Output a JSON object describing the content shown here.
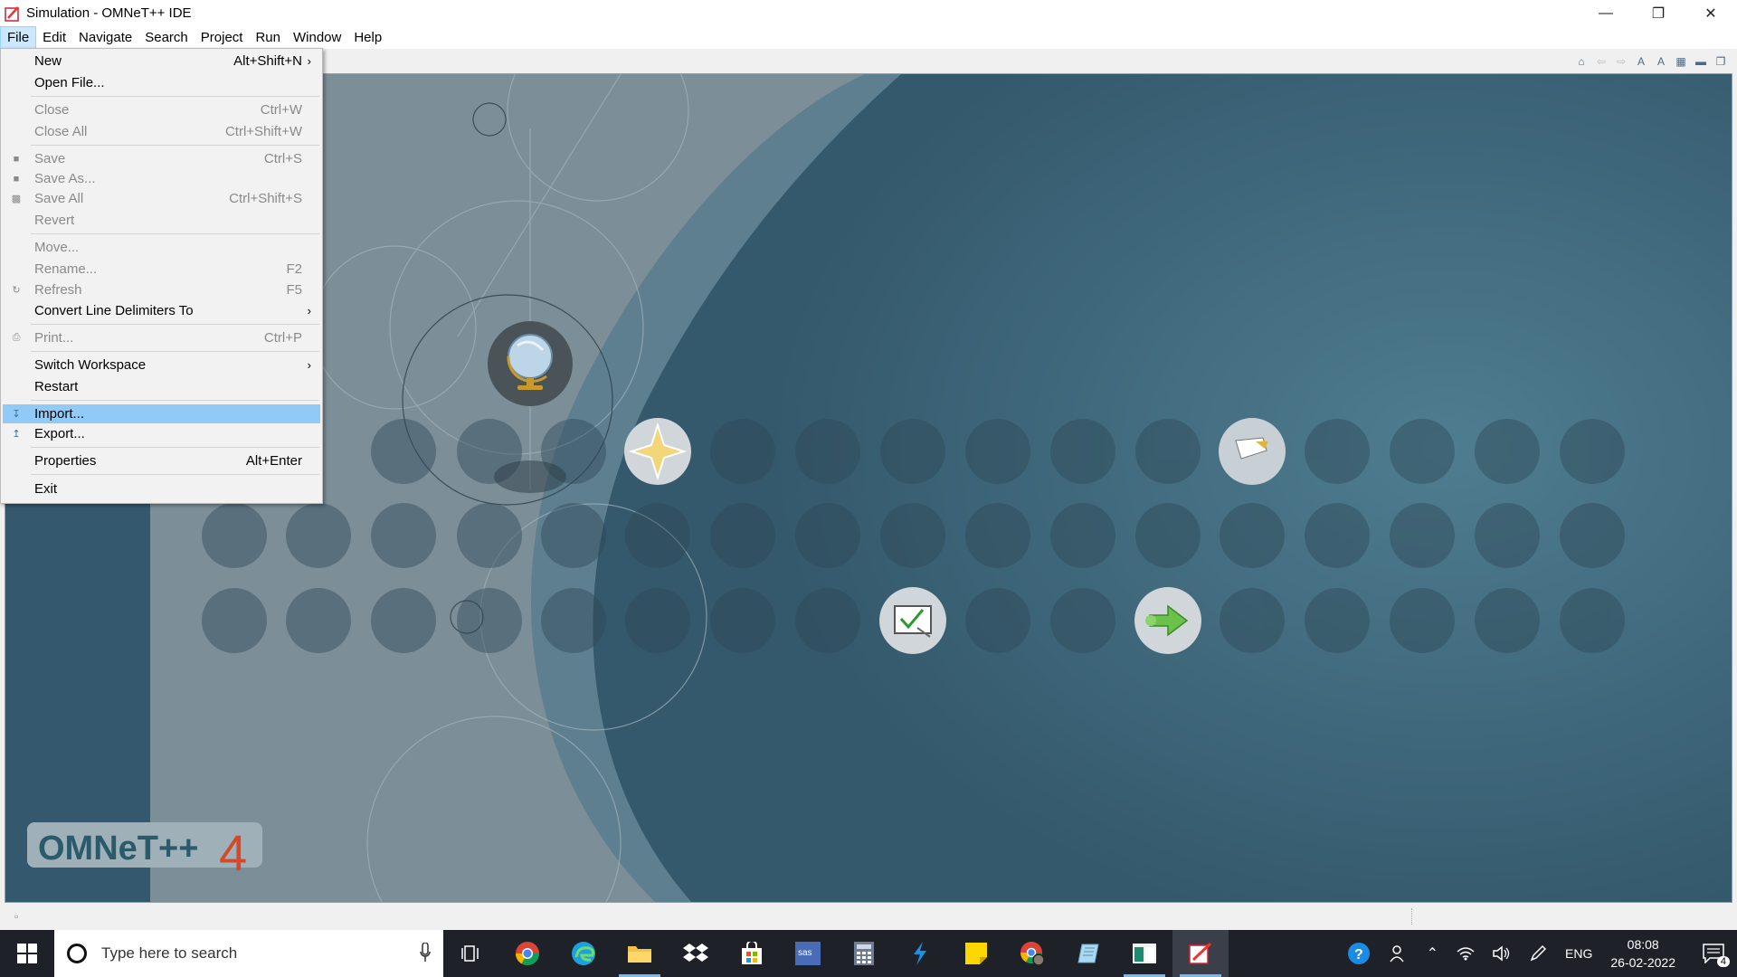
{
  "window": {
    "title": "Simulation - OMNeT++ IDE"
  },
  "menubar": [
    "File",
    "Edit",
    "Navigate",
    "Search",
    "Project",
    "Run",
    "Window",
    "Help"
  ],
  "file_menu": {
    "items": [
      {
        "label": "New",
        "shortcut": "Alt+Shift+N",
        "submenu": true,
        "disabled": false
      },
      {
        "label": "Open File...",
        "shortcut": "",
        "disabled": false
      },
      {
        "label": "Close",
        "shortcut": "Ctrl+W",
        "disabled": true
      },
      {
        "label": "Close All",
        "shortcut": "Ctrl+Shift+W",
        "disabled": true
      },
      {
        "label": "Save",
        "shortcut": "Ctrl+S",
        "disabled": true
      },
      {
        "label": "Save As...",
        "shortcut": "",
        "disabled": true
      },
      {
        "label": "Save All",
        "shortcut": "Ctrl+Shift+S",
        "disabled": true
      },
      {
        "label": "Revert",
        "shortcut": "",
        "disabled": true
      },
      {
        "label": "Move...",
        "shortcut": "",
        "disabled": true
      },
      {
        "label": "Rename...",
        "shortcut": "F2",
        "disabled": true
      },
      {
        "label": "Refresh",
        "shortcut": "F5",
        "disabled": true
      },
      {
        "label": "Convert Line Delimiters To",
        "shortcut": "",
        "submenu": true,
        "disabled": false
      },
      {
        "label": "Print...",
        "shortcut": "Ctrl+P",
        "disabled": true
      },
      {
        "label": "Switch Workspace",
        "shortcut": "",
        "submenu": true,
        "disabled": false
      },
      {
        "label": "Restart",
        "shortcut": "",
        "disabled": false
      },
      {
        "label": "Import...",
        "shortcut": "",
        "disabled": false,
        "highlighted": true
      },
      {
        "label": "Export...",
        "shortcut": "",
        "disabled": false
      },
      {
        "label": "Properties",
        "shortcut": "Alt+Enter",
        "disabled": false
      },
      {
        "label": "Exit",
        "shortcut": "",
        "disabled": false
      }
    ],
    "submenu_arrow": "›"
  },
  "welcome": {
    "logo_text": "OMNeT++",
    "logo_version": "4",
    "buttons": [
      "overview-globe-icon",
      "whats-new-star-icon",
      "samples-icon",
      "tutorials-icon",
      "workbench-arrow-icon"
    ]
  },
  "taskbar": {
    "search_placeholder": "Type here to search",
    "language": "ENG",
    "time": "08:08",
    "date": "26-02-2022",
    "notification_count": "4",
    "accent_color": "#76b9ed"
  }
}
